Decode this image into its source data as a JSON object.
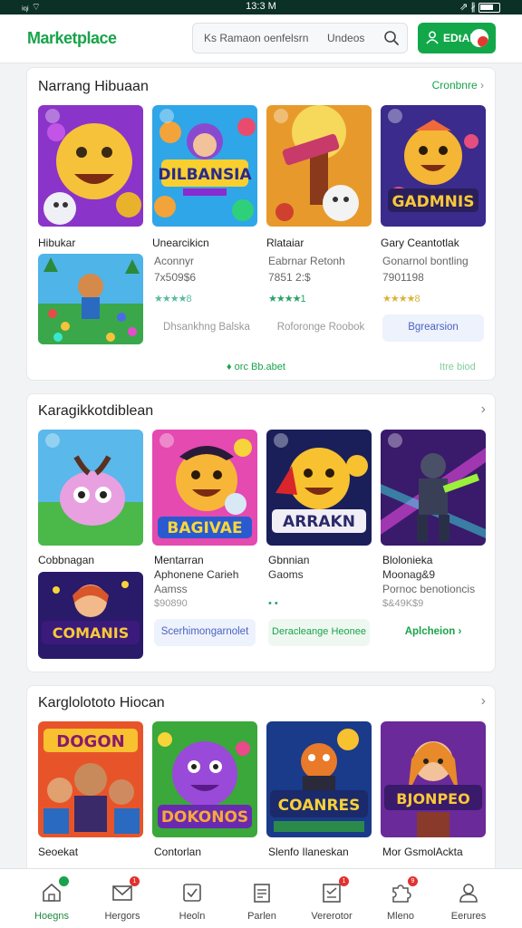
{
  "status_bar": {
    "left": "ᵢₒ᷊ᵢ ⌔",
    "time": "13:3 M",
    "right": "⇗ ∦"
  },
  "app": {
    "brand": "Marketplace"
  },
  "search": {
    "placeholder": "Ks Ramaon oenfelsrn",
    "scope": "Undeos"
  },
  "account_button": {
    "label": "EDtAN"
  },
  "sections": [
    {
      "title": "Narrang Hibuaan",
      "link": "Cronbnre",
      "tiles": [
        {
          "art": "smiley-yellow",
          "label": "Hibukar",
          "sub": "",
          "meta": "",
          "stars": ""
        },
        {
          "art": "dilbansia-logo",
          "label": "Unearcikicn",
          "sub": "Aconnyr",
          "meta": "7x509$6",
          "stars": "★★★★8"
        },
        {
          "art": "ship-tower",
          "label": "Rlataiar",
          "sub": "Eabrnar Retonh",
          "meta": "7851 2:$",
          "stars": "★★★★1"
        },
        {
          "art": "gadmnis-logo",
          "label": "Gary Ceantotlak",
          "sub": "Gonarnol bontling",
          "meta": "7901198",
          "stars": "★★★★8"
        },
        {
          "art": "island-hero",
          "label": "",
          "sub": "",
          "meta": "",
          "stars": ""
        }
      ],
      "chips": [
        "Dhsankhng Balska",
        "Roforonge Roobok",
        "Bgrearsion"
      ],
      "footer_links": [
        "♦ orc Bb.abet",
        "Itre biod"
      ]
    },
    {
      "title": "Karagikkotdiblean",
      "link": "",
      "tiles": [
        {
          "art": "pink-critter",
          "label": "Cobbnagan",
          "sub": "",
          "meta": "",
          "stars": ""
        },
        {
          "art": "bagivae-logo",
          "label": "Mentarran",
          "sub": "Aphonene Carieh",
          "meta": "Aamss",
          "stars": "$90890"
        },
        {
          "art": "arrakn-logo",
          "label": "Gbnnian",
          "sub": "Gaoms",
          "meta": "",
          "stars": ""
        },
        {
          "art": "neon-knight",
          "label": "Blolonieka",
          "sub": "Moonag&9",
          "meta": "Pornoc benotioncis",
          "stars": "$&49K$9"
        },
        {
          "art": "comanis-logo",
          "label": "",
          "sub": "",
          "meta": "",
          "stars": ""
        }
      ],
      "chips": [
        "Scerhimongarnolet",
        "Deracleange Heonee",
        "Aplcheion ›"
      ]
    },
    {
      "title": "Karglolototo Hiocan",
      "link": "",
      "tiles": [
        {
          "art": "dogon-crew",
          "label": "Seoekat",
          "sub": "",
          "meta": "",
          "stars": ""
        },
        {
          "art": "dokonos-purple",
          "label": "Contorlan",
          "sub": "",
          "meta": "",
          "stars": ""
        },
        {
          "art": "coanres-logo",
          "label": "Slenfo Ilaneskan",
          "sub": "",
          "meta": "",
          "stars": ""
        },
        {
          "art": "bjonpeo-heroine",
          "label": "Mor GsmolAckta",
          "sub": "",
          "meta": "",
          "stars": ""
        }
      ]
    }
  ],
  "bottom_nav": [
    {
      "icon": "home-icon",
      "label": "Hoegns",
      "badge": "",
      "active": true
    },
    {
      "icon": "mail-icon",
      "label": "Hergors",
      "badge": "1",
      "active": false
    },
    {
      "icon": "calendar-icon",
      "label": "Heoln",
      "badge": "",
      "active": false
    },
    {
      "icon": "notepad-icon",
      "label": "Parlen",
      "badge": "",
      "active": false
    },
    {
      "icon": "checklist-icon",
      "label": "Vererotor",
      "badge": "1",
      "active": false
    },
    {
      "icon": "puzzle-icon",
      "label": "Mleno",
      "badge": "9",
      "active": false
    },
    {
      "icon": "person-icon",
      "label": "Eerures",
      "badge": "",
      "active": false
    }
  ],
  "colors": {
    "brand": "#19a34a",
    "status_bar": "#0b3026",
    "badge": "#e0322f"
  }
}
